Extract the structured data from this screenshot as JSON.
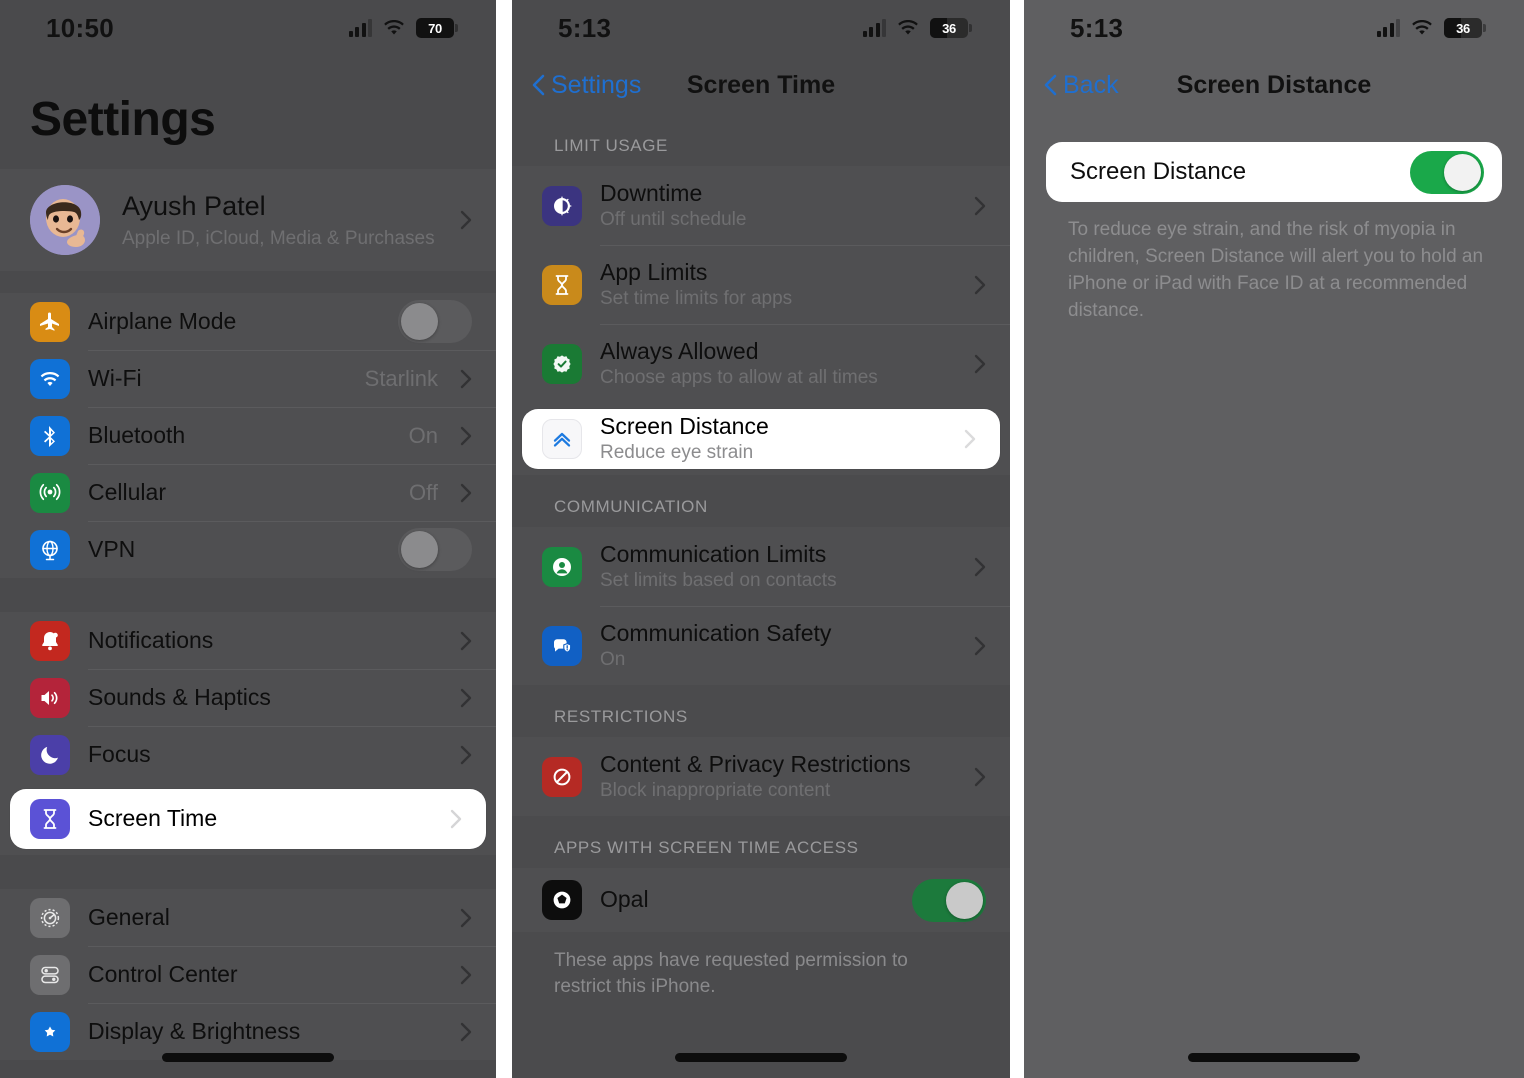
{
  "panels": [
    {
      "name": "settings-root",
      "status": {
        "time": "10:50",
        "battery": "70"
      },
      "title": "Settings",
      "account": {
        "name": "Ayush Patel",
        "subtitle": "Apple ID, iCloud, Media & Purchases",
        "avatar_glyph": "👦"
      },
      "group_connectivity": [
        {
          "label": "Airplane Mode",
          "icon": "airplane-icon",
          "icon_color": "#d98c14",
          "control": "toggle",
          "toggle": "off"
        },
        {
          "label": "Wi-Fi",
          "icon": "wifi-icon",
          "icon_color": "#1071d6",
          "control": "value",
          "value": "Starlink"
        },
        {
          "label": "Bluetooth",
          "icon": "bluetooth-icon",
          "icon_color": "#1071d6",
          "control": "value",
          "value": "On"
        },
        {
          "label": "Cellular",
          "icon": "cellular-icon",
          "icon_color": "#1a8a42",
          "control": "value",
          "value": "Off"
        },
        {
          "label": "VPN",
          "icon": "vpn-globe-icon",
          "icon_color": "#1071d6",
          "control": "toggle",
          "toggle": "off"
        }
      ],
      "group_system": [
        {
          "label": "Notifications",
          "icon": "bell-icon",
          "icon_color": "#c3281f",
          "control": "chevron",
          "highlight": false
        },
        {
          "label": "Sounds & Haptics",
          "icon": "speaker-icon",
          "icon_color": "#b4243a",
          "control": "chevron",
          "highlight": false
        },
        {
          "label": "Focus",
          "icon": "moon-icon",
          "icon_color": "#4b3fa8",
          "control": "chevron",
          "highlight": false
        },
        {
          "label": "Screen Time",
          "icon": "hourglass-icon",
          "icon_color": "#5b52d6",
          "control": "chevron",
          "highlight": true
        }
      ],
      "group_general": [
        {
          "label": "General",
          "icon": "gear-icon",
          "icon_color": "#6e6e70",
          "control": "chevron"
        },
        {
          "label": "Control Center",
          "icon": "control-center-icon",
          "icon_color": "#6e6e70",
          "control": "chevron"
        },
        {
          "label": "Display & Brightness",
          "icon": "brightness-icon",
          "icon_color": "#1071d6",
          "control": "chevron"
        }
      ]
    },
    {
      "name": "screen-time",
      "status": {
        "time": "5:13",
        "battery": "36"
      },
      "nav": {
        "back_label": "Settings",
        "title": "Screen Time"
      },
      "sections": [
        {
          "header": "LIMIT USAGE",
          "rows": [
            {
              "title": "Downtime",
              "subtitle": "Off until schedule",
              "icon": "downtime-icon",
              "icon_color": "#3b3480",
              "highlight": false
            },
            {
              "title": "App Limits",
              "subtitle": "Set time limits for apps",
              "icon": "hourglass-icon",
              "icon_color": "#c98a1b",
              "highlight": false
            },
            {
              "title": "Always Allowed",
              "subtitle": "Choose apps to allow at all times",
              "icon": "check-badge-icon",
              "icon_color": "#1a7a34",
              "highlight": false
            },
            {
              "title": "Screen Distance",
              "subtitle": "Reduce eye strain",
              "icon": "screen-distance-icon",
              "icon_color": "#ffffff",
              "highlight": true
            }
          ]
        },
        {
          "header": "COMMUNICATION",
          "rows": [
            {
              "title": "Communication Limits",
              "subtitle": "Set limits based on contacts",
              "icon": "person-circle-icon",
              "icon_color": "#1a8a42",
              "highlight": false
            },
            {
              "title": "Communication Safety",
              "subtitle": "On",
              "icon": "message-shield-icon",
              "icon_color": "#1160c4",
              "highlight": false
            }
          ]
        },
        {
          "header": "RESTRICTIONS",
          "rows": [
            {
              "title": "Content & Privacy Restrictions",
              "subtitle": "Block inappropriate content",
              "icon": "no-entry-icon",
              "icon_color": "#b52a24",
              "highlight": false
            }
          ]
        },
        {
          "header": "APPS WITH SCREEN TIME ACCESS",
          "rows": [
            {
              "title": "Opal",
              "subtitle": "",
              "icon": "opal-app-icon",
              "icon_color": "#0d0d0d",
              "control": "toggle",
              "toggle": "on"
            }
          ],
          "footnote": "These apps have requested permission to restrict this iPhone."
        }
      ]
    },
    {
      "name": "screen-distance",
      "status": {
        "time": "5:13",
        "battery": "36"
      },
      "nav": {
        "back_label": "Back",
        "title": "Screen Distance"
      },
      "card": {
        "label": "Screen Distance",
        "toggle": "on"
      },
      "note": "To reduce eye strain, and the risk of myopia in children, Screen Distance will alert you to hold an iPhone or iPad with Face ID at a recommended distance."
    }
  ],
  "colors": {
    "panel_bg_1": "#4a4a4c",
    "panel_bg_2": "#4b4b4d",
    "panel_bg_3": "#5f5f61",
    "card_bg": "#4f4f51",
    "highlight_bg": "#ffffff",
    "accent_blue": "#1f6fd0",
    "toggle_on_green": "#1aa84a",
    "gap": "#ffffff"
  }
}
